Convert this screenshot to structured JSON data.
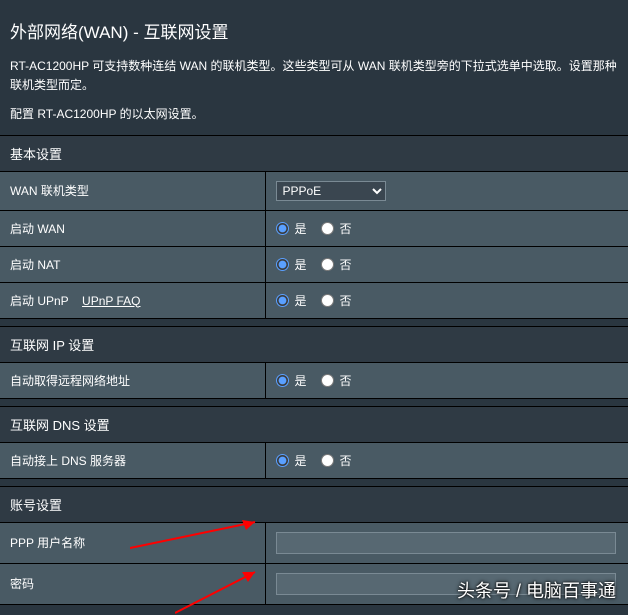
{
  "title": "外部网络(WAN) - 互联网设置",
  "desc1": "RT-AC1200HP 可支持数种连结 WAN 的联机类型。这些类型可从 WAN 联机类型旁的下拉式选单中选取。设置那种联机类型而定。",
  "desc2": "配置 RT-AC1200HP 的以太网设置。",
  "sections": {
    "basic": "基本设置",
    "ip": "互联网 IP 设置",
    "dns": "互联网 DNS 设置",
    "account": "账号设置"
  },
  "rows": {
    "wan_type_label": "WAN 联机类型",
    "wan_type_value": "PPPoE",
    "enable_wan_label": "启动 WAN",
    "enable_nat_label": "启动 NAT",
    "enable_upnp_label": "启动 UPnP",
    "upnp_faq": "UPnP FAQ",
    "auto_ip_label": "自动取得远程网络地址",
    "auto_dns_label": "自动接上 DNS 服务器",
    "ppp_user_label": "PPP 用户名称",
    "password_label": "密码"
  },
  "radio": {
    "yes": "是",
    "no": "否"
  },
  "watermark": "头条号 / 电脑百事通"
}
